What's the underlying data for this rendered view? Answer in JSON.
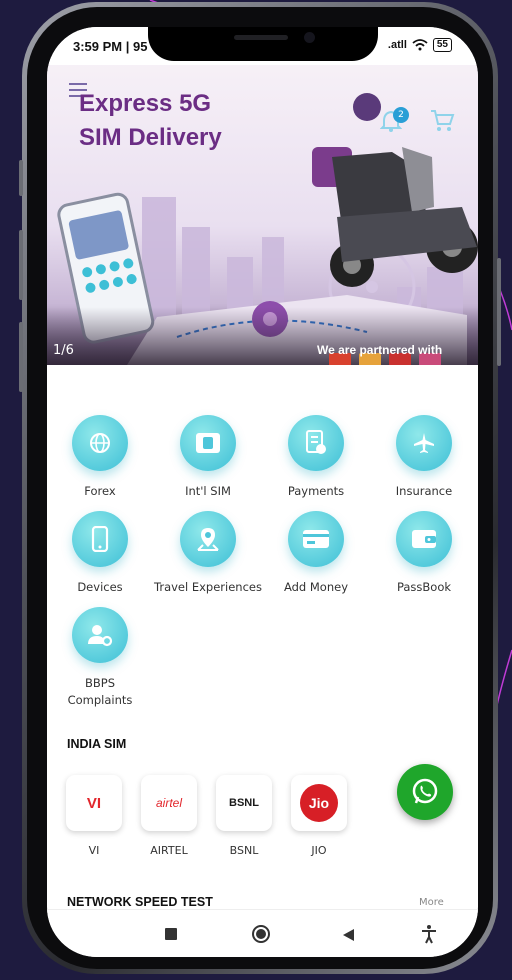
{
  "status": {
    "time": "3:59 PM | 95",
    "signal": ".atll",
    "battery": "55"
  },
  "banner": {
    "title_line1": "Express 5G",
    "title_line2": "SIM Delivery",
    "notification_count": "2",
    "slide_counter": "1/6",
    "partner_text": "We are partnered with",
    "slide_count": 6,
    "active_slide": 1
  },
  "services": [
    {
      "label": "Forex",
      "icon": "globe-icon"
    },
    {
      "label": "Int'l SIM",
      "icon": "sim-card-icon"
    },
    {
      "label": "Payments",
      "icon": "bill-icon"
    },
    {
      "label": "Insurance",
      "icon": "airplane-icon"
    },
    {
      "label": "Devices",
      "icon": "phone-icon"
    },
    {
      "label": "Travel Experiences",
      "icon": "location-pin-icon"
    },
    {
      "label": "Add Money",
      "icon": "card-icon"
    },
    {
      "label": "PassBook",
      "icon": "wallet-icon"
    },
    {
      "label": "BBPS\nComplaints",
      "icon": "user-settings-icon"
    }
  ],
  "india_sim": {
    "title": "INDIA SIM",
    "operators": [
      {
        "label": "VI",
        "logo": "VI"
      },
      {
        "label": "AIRTEL",
        "logo": "airtel"
      },
      {
        "label": "BSNL",
        "logo": "BSNL"
      },
      {
        "label": "JIO",
        "logo": "Jio"
      }
    ]
  },
  "speed_test": {
    "title": "NETWORK SPEED TEST",
    "more": "More"
  },
  "colors": {
    "background": "#1e1b3f",
    "accent": "#3dbfd6",
    "banner_title": "#6b2d84",
    "whatsapp": "#1fa62b"
  }
}
